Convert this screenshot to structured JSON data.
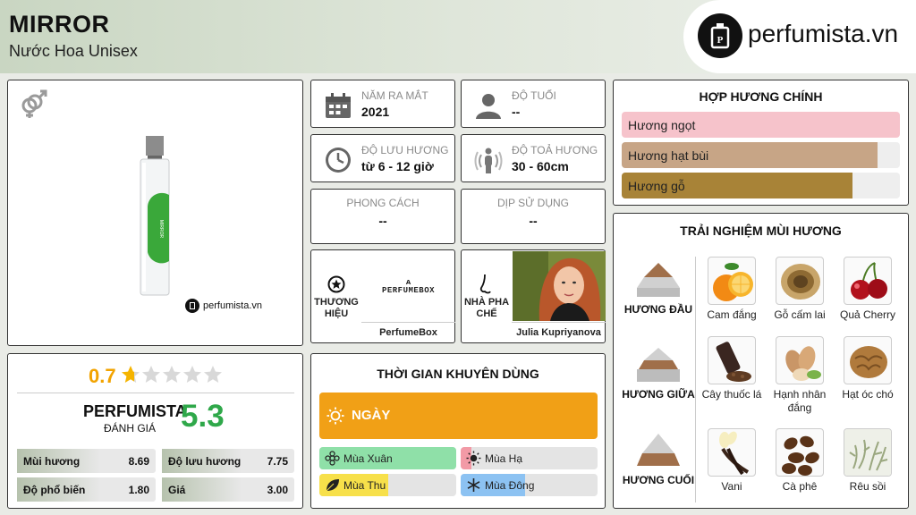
{
  "header": {
    "title": "MIRROR",
    "subtitle": "Nước Hoa Unisex",
    "brand": "perfumista.vn"
  },
  "product": {
    "gender_icon": "unisex-icon",
    "watermark": "perfumista.vn",
    "bottle_label": "MIRROR",
    "accent_color": "#3aa83a"
  },
  "info": {
    "year_label": "NĂM RA MẮT",
    "year_value": "2021",
    "age_label": "ĐỘ TUỔI",
    "age_value": "--",
    "longevity_label": "ĐỘ LƯU HƯƠNG",
    "longevity_value": "từ 6 - 12 giờ",
    "sillage_label": "ĐỘ TOẢ HƯƠNG",
    "sillage_value": "30 - 60cm",
    "style_label": "PHONG CÁCH",
    "style_value": "--",
    "occasion_label": "DỊP SỬ DỤNG",
    "occasion_value": "--"
  },
  "brand_card": {
    "label_line1": "THƯƠNG",
    "label_line2": "HIỆU",
    "logo_text": "PERFUMEBOX",
    "name": "PerfumeBox"
  },
  "perfumer_card": {
    "label_line1": "NHÀ PHA",
    "label_line2": "CHẾ",
    "name": "Julia Kupriyanova"
  },
  "accords": {
    "title": "HỢP HƯƠNG CHÍNH",
    "items": [
      {
        "label": "Hương ngọt",
        "value": 1.0,
        "color": "#f6c3cb"
      },
      {
        "label": "Hương hạt bùi",
        "value": 0.92,
        "color": "#c7a586"
      },
      {
        "label": "Hương gỗ",
        "value": 0.83,
        "color": "#a88337"
      }
    ]
  },
  "rating": {
    "score": "0.7",
    "stars_filled": 0.7,
    "stars_total": 5,
    "brand_label": "PERFUMISTA",
    "brand_sublabel": "ĐÁNH GIÁ",
    "brand_score": "5.3",
    "rows": [
      {
        "label": "Mùi hương",
        "value": "8.69"
      },
      {
        "label": "Độ lưu hương",
        "value": "7.75"
      },
      {
        "label": "Độ phổ biến",
        "value": "1.80"
      },
      {
        "label": "Giá",
        "value": "3.00"
      }
    ]
  },
  "usage": {
    "title": "THỜI GIAN KHUYÊN DÙNG",
    "day_label": "NGÀY",
    "seasons": [
      {
        "label": "Mùa Xuân",
        "value": 1.0,
        "color": "#8fe0a8"
      },
      {
        "label": "Mùa Hạ",
        "value": 0.08,
        "color": "#f29aa6"
      },
      {
        "label": "Mùa Thu",
        "value": 0.5,
        "color": "#f7e04a"
      },
      {
        "label": "Mùa Đông",
        "value": 0.47,
        "color": "#8cc2f2"
      }
    ]
  },
  "notes": {
    "title": "TRẢI NGHIỆM MÙI HƯƠNG",
    "top_label": "HƯƠNG ĐẦU",
    "heart_label": "HƯƠNG GIỮA",
    "base_label": "HƯƠNG CUỐI",
    "top": [
      "Cam đắng",
      "Gỗ cấm lai",
      "Quả Cherry"
    ],
    "heart": [
      "Cây thuốc lá",
      "Hạnh nhân đắng",
      "Hạt óc chó"
    ],
    "base": [
      "Vani",
      "Cà phê",
      "Rêu sồi"
    ]
  }
}
